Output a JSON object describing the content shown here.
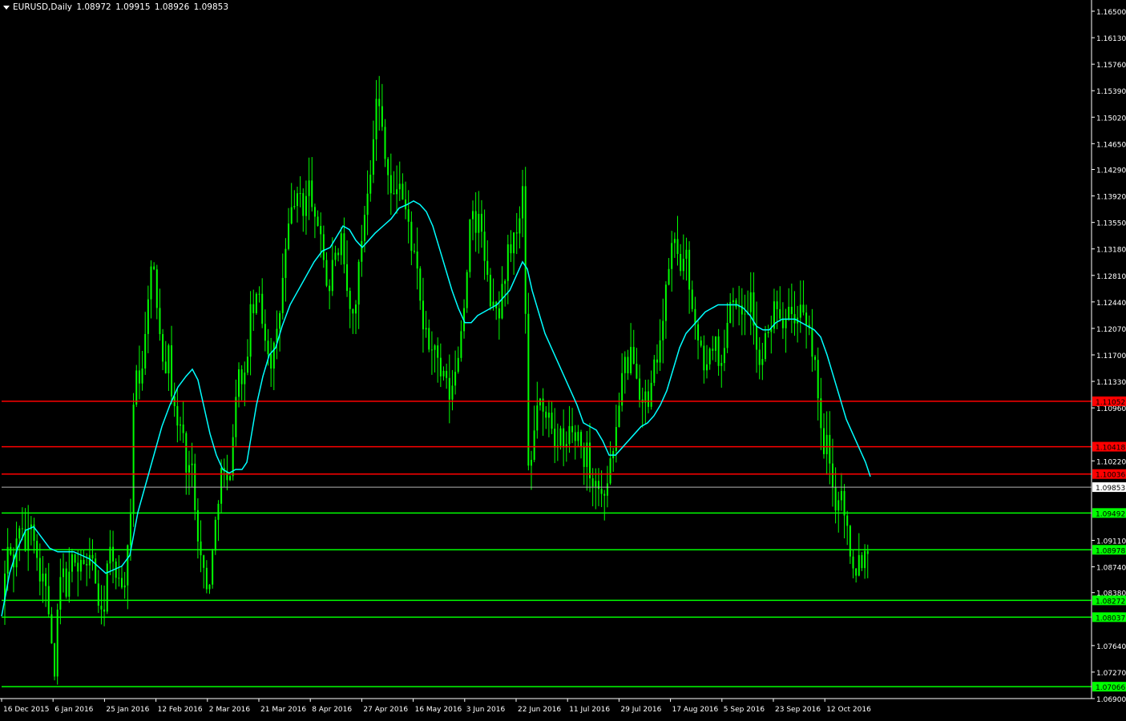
{
  "header": {
    "symbol_timeframe": "EURUSD,Daily",
    "ohlc": [
      "1.08972",
      "1.09915",
      "1.08926",
      "1.09853"
    ]
  },
  "chart_data": {
    "type": "candlestick",
    "symbol": "EURUSD",
    "timeframe": "Daily",
    "ylim": [
      1.069,
      1.165
    ],
    "y_ticks": [
      "1.16500",
      "1.16130",
      "1.15760",
      "1.15390",
      "1.15020",
      "1.14650",
      "1.14290",
      "1.13920",
      "1.13550",
      "1.13180",
      "1.12810",
      "1.12440",
      "1.12070",
      "1.11700",
      "1.11330",
      "1.10960",
      "1.10220",
      "1.09110",
      "1.08740",
      "1.08380",
      "1.07640",
      "1.07270",
      "1.06900"
    ],
    "x_labels": [
      "16 Dec 2015",
      "6 Jan 2016",
      "25 Jan 2016",
      "12 Feb 2016",
      "2 Mar 2016",
      "21 Mar 2016",
      "8 Apr 2016",
      "27 Apr 2016",
      "16 May 2016",
      "3 Jun 2016",
      "22 Jun 2016",
      "11 Jul 2016",
      "29 Jul 2016",
      "17 Aug 2016",
      "5 Sep 2016",
      "23 Sep 2016",
      "12 Oct 2016"
    ],
    "current_price": "1.09853",
    "resistance_levels": [
      "1.11052",
      "1.10418",
      "1.10036"
    ],
    "support_levels": [
      "1.09492",
      "1.08978",
      "1.08272",
      "1.08037",
      "1.07066"
    ],
    "close_path": [
      [
        0,
        1.0825
      ],
      [
        8,
        1.09
      ],
      [
        15,
        1.088
      ],
      [
        22,
        1.0935
      ],
      [
        30,
        1.09
      ],
      [
        38,
        1.095
      ],
      [
        45,
        1.087
      ],
      [
        52,
        1.086
      ],
      [
        58,
        1.082
      ],
      [
        63,
        1.075
      ],
      [
        66,
        1.072
      ],
      [
        70,
        1.081
      ],
      [
        75,
        1.088
      ],
      [
        80,
        1.084
      ],
      [
        85,
        1.086
      ],
      [
        90,
        1.09
      ],
      [
        95,
        1.087
      ],
      [
        100,
        1.089
      ],
      [
        105,
        1.086
      ],
      [
        110,
        1.09
      ],
      [
        115,
        1.087
      ],
      [
        120,
        1.083
      ],
      [
        124,
        1.08
      ],
      [
        128,
        1.082
      ],
      [
        132,
        1.088
      ],
      [
        137,
        1.09
      ],
      [
        141,
        1.085
      ],
      [
        145,
        1.088
      ],
      [
        150,
        1.084
      ],
      [
        154,
        1.086
      ],
      [
        158,
        1.09
      ],
      [
        162,
        1.095
      ],
      [
        164,
        1.108
      ],
      [
        167,
        1.118
      ],
      [
        170,
        1.112
      ],
      [
        174,
        1.115
      ],
      [
        178,
        1.117
      ],
      [
        182,
        1.125
      ],
      [
        185,
        1.128
      ],
      [
        188,
        1.13
      ],
      [
        192,
        1.126
      ],
      [
        196,
        1.122
      ],
      [
        200,
        1.118
      ],
      [
        204,
        1.115
      ],
      [
        208,
        1.118
      ],
      [
        212,
        1.112
      ],
      [
        216,
        1.11
      ],
      [
        220,
        1.106
      ],
      [
        224,
        1.108
      ],
      [
        228,
        1.104
      ],
      [
        232,
        1.1
      ],
      [
        236,
        1.103
      ],
      [
        240,
        1.098
      ],
      [
        244,
        1.093
      ],
      [
        248,
        1.089
      ],
      [
        252,
        1.087
      ],
      [
        256,
        1.084
      ],
      [
        260,
        1.086
      ],
      [
        264,
        1.09
      ],
      [
        268,
        1.095
      ],
      [
        272,
        1.099
      ],
      [
        276,
        1.102
      ],
      [
        280,
        1.098
      ],
      [
        284,
        1.1
      ],
      [
        288,
        1.105
      ],
      [
        292,
        1.11
      ],
      [
        296,
        1.116
      ],
      [
        300,
        1.112
      ],
      [
        304,
        1.114
      ],
      [
        308,
        1.119
      ],
      [
        312,
        1.125
      ],
      [
        316,
        1.122
      ],
      [
        320,
        1.127
      ],
      [
        324,
        1.123
      ],
      [
        328,
        1.12
      ],
      [
        332,
        1.118
      ],
      [
        336,
        1.116
      ],
      [
        340,
        1.118
      ],
      [
        344,
        1.12
      ],
      [
        348,
        1.124
      ],
      [
        352,
        1.129
      ],
      [
        356,
        1.133
      ],
      [
        360,
        1.136
      ],
      [
        364,
        1.139
      ],
      [
        368,
        1.138
      ],
      [
        372,
        1.14
      ],
      [
        376,
        1.137
      ],
      [
        380,
        1.139
      ],
      [
        384,
        1.141
      ],
      [
        388,
        1.138
      ],
      [
        392,
        1.134
      ],
      [
        396,
        1.136
      ],
      [
        400,
        1.133
      ],
      [
        404,
        1.128
      ],
      [
        408,
        1.125
      ],
      [
        412,
        1.129
      ],
      [
        416,
        1.132
      ],
      [
        420,
        1.13
      ],
      [
        424,
        1.133
      ],
      [
        428,
        1.128
      ],
      [
        432,
        1.125
      ],
      [
        436,
        1.122
      ],
      [
        440,
        1.123
      ],
      [
        444,
        1.127
      ],
      [
        448,
        1.132
      ],
      [
        452,
        1.136
      ],
      [
        456,
        1.14
      ],
      [
        460,
        1.143
      ],
      [
        464,
        1.148
      ],
      [
        468,
        1.153
      ],
      [
        472,
        1.151
      ],
      [
        476,
        1.148
      ],
      [
        480,
        1.144
      ],
      [
        484,
        1.141
      ],
      [
        488,
        1.138
      ],
      [
        492,
        1.14
      ],
      [
        496,
        1.142
      ],
      [
        500,
        1.139
      ],
      [
        504,
        1.137
      ],
      [
        508,
        1.135
      ],
      [
        512,
        1.132
      ],
      [
        516,
        1.13
      ],
      [
        520,
        1.127
      ],
      [
        524,
        1.122
      ],
      [
        528,
        1.12
      ],
      [
        532,
        1.119
      ],
      [
        536,
        1.117
      ],
      [
        540,
        1.119
      ],
      [
        544,
        1.116
      ],
      [
        548,
        1.113
      ],
      [
        552,
        1.115
      ],
      [
        556,
        1.112
      ],
      [
        560,
        1.111
      ],
      [
        564,
        1.113
      ],
      [
        568,
        1.116
      ],
      [
        572,
        1.119
      ],
      [
        576,
        1.123
      ],
      [
        580,
        1.128
      ],
      [
        584,
        1.135
      ],
      [
        588,
        1.136
      ],
      [
        592,
        1.134
      ],
      [
        596,
        1.138
      ],
      [
        600,
        1.132
      ],
      [
        604,
        1.129
      ],
      [
        608,
        1.126
      ],
      [
        612,
        1.123
      ],
      [
        616,
        1.124
      ],
      [
        620,
        1.122
      ],
      [
        624,
        1.126
      ],
      [
        628,
        1.128
      ],
      [
        632,
        1.132
      ],
      [
        636,
        1.13
      ],
      [
        640,
        1.134
      ],
      [
        644,
        1.133
      ],
      [
        648,
        1.138
      ],
      [
        652,
        1.142
      ],
      [
        655,
        1.106
      ],
      [
        658,
        1.099
      ],
      [
        662,
        1.103
      ],
      [
        666,
        1.108
      ],
      [
        670,
        1.112
      ],
      [
        674,
        1.109
      ],
      [
        678,
        1.107
      ],
      [
        682,
        1.11
      ],
      [
        686,
        1.108
      ],
      [
        690,
        1.105
      ],
      [
        694,
        1.104
      ],
      [
        698,
        1.106
      ],
      [
        702,
        1.103
      ],
      [
        706,
        1.105
      ],
      [
        710,
        1.108
      ],
      [
        714,
        1.104
      ],
      [
        718,
        1.107
      ],
      [
        722,
        1.105
      ],
      [
        726,
        1.102
      ],
      [
        730,
        1.104
      ],
      [
        734,
        1.101
      ],
      [
        738,
        1.099
      ],
      [
        742,
        1.1
      ],
      [
        746,
        1.098
      ],
      [
        750,
        1.097
      ],
      [
        754,
        1.099
      ],
      [
        758,
        1.101
      ],
      [
        762,
        1.103
      ],
      [
        766,
        1.106
      ],
      [
        770,
        1.11
      ],
      [
        774,
        1.114
      ],
      [
        778,
        1.116
      ],
      [
        782,
        1.113
      ],
      [
        786,
        1.119
      ],
      [
        790,
        1.116
      ],
      [
        794,
        1.114
      ],
      [
        798,
        1.11
      ],
      [
        802,
        1.113
      ],
      [
        806,
        1.108
      ],
      [
        810,
        1.112
      ],
      [
        814,
        1.115
      ],
      [
        818,
        1.117
      ],
      [
        822,
        1.12
      ],
      [
        826,
        1.122
      ],
      [
        830,
        1.127
      ],
      [
        834,
        1.131
      ],
      [
        838,
        1.133
      ],
      [
        842,
        1.132
      ],
      [
        846,
        1.13
      ],
      [
        850,
        1.129
      ],
      [
        854,
        1.131
      ],
      [
        858,
        1.127
      ],
      [
        862,
        1.124
      ],
      [
        866,
        1.12
      ],
      [
        870,
        1.118
      ],
      [
        874,
        1.117
      ],
      [
        878,
        1.115
      ],
      [
        882,
        1.116
      ],
      [
        886,
        1.118
      ],
      [
        890,
        1.12
      ],
      [
        894,
        1.117
      ],
      [
        898,
        1.115
      ],
      [
        902,
        1.118
      ],
      [
        906,
        1.123
      ],
      [
        910,
        1.125
      ],
      [
        914,
        1.126
      ],
      [
        918,
        1.124
      ],
      [
        922,
        1.122
      ],
      [
        926,
        1.124
      ],
      [
        930,
        1.123
      ],
      [
        934,
        1.126
      ],
      [
        938,
        1.122
      ],
      [
        942,
        1.118
      ],
      [
        946,
        1.115
      ],
      [
        950,
        1.117
      ],
      [
        954,
        1.12
      ],
      [
        958,
        1.119
      ],
      [
        962,
        1.123
      ],
      [
        966,
        1.125
      ],
      [
        970,
        1.124
      ],
      [
        974,
        1.121
      ],
      [
        978,
        1.123
      ],
      [
        982,
        1.125
      ],
      [
        986,
        1.123
      ],
      [
        990,
        1.121
      ],
      [
        994,
        1.124
      ],
      [
        998,
        1.123
      ],
      [
        1002,
        1.121
      ],
      [
        1006,
        1.12
      ],
      [
        1010,
        1.119
      ],
      [
        1014,
        1.116
      ],
      [
        1018,
        1.113
      ],
      [
        1022,
        1.106
      ],
      [
        1026,
        1.103
      ],
      [
        1030,
        1.105
      ],
      [
        1034,
        1.101
      ],
      [
        1038,
        1.097
      ],
      [
        1042,
        1.096
      ],
      [
        1046,
        1.099
      ],
      [
        1050,
        1.096
      ],
      [
        1054,
        1.094
      ],
      [
        1058,
        1.09
      ],
      [
        1062,
        1.088
      ],
      [
        1066,
        1.087
      ],
      [
        1070,
        1.089
      ],
      [
        1074,
        1.088
      ],
      [
        1078,
        1.09
      ],
      [
        1082,
        1.0899
      ],
      [
        1084,
        1.0985
      ]
    ],
    "ma_path": [
      [
        0,
        1.0805
      ],
      [
        10,
        1.0865
      ],
      [
        20,
        1.09
      ],
      [
        30,
        1.0925
      ],
      [
        40,
        1.093
      ],
      [
        50,
        1.0915
      ],
      [
        60,
        1.09
      ],
      [
        70,
        1.0895
      ],
      [
        80,
        1.0895
      ],
      [
        90,
        1.0895
      ],
      [
        100,
        1.089
      ],
      [
        110,
        1.0885
      ],
      [
        120,
        1.0875
      ],
      [
        130,
        1.0865
      ],
      [
        140,
        1.087
      ],
      [
        150,
        1.0875
      ],
      [
        160,
        1.089
      ],
      [
        170,
        1.095
      ],
      [
        180,
        1.099
      ],
      [
        190,
        1.103
      ],
      [
        200,
        1.107
      ],
      [
        210,
        1.11
      ],
      [
        220,
        1.1125
      ],
      [
        230,
        1.114
      ],
      [
        238,
        1.115
      ],
      [
        245,
        1.1135
      ],
      [
        252,
        1.11
      ],
      [
        260,
        1.106
      ],
      [
        268,
        1.103
      ],
      [
        276,
        1.101
      ],
      [
        284,
        1.1005
      ],
      [
        292,
        1.101
      ],
      [
        300,
        1.101
      ],
      [
        306,
        1.102
      ],
      [
        312,
        1.106
      ],
      [
        318,
        1.11
      ],
      [
        326,
        1.114
      ],
      [
        334,
        1.117
      ],
      [
        342,
        1.118
      ],
      [
        350,
        1.121
      ],
      [
        360,
        1.124
      ],
      [
        370,
        1.126
      ],
      [
        380,
        1.128
      ],
      [
        390,
        1.13
      ],
      [
        400,
        1.1315
      ],
      [
        410,
        1.132
      ],
      [
        418,
        1.1335
      ],
      [
        426,
        1.135
      ],
      [
        434,
        1.1345
      ],
      [
        442,
        1.133
      ],
      [
        450,
        1.132
      ],
      [
        458,
        1.133
      ],
      [
        466,
        1.134
      ],
      [
        476,
        1.135
      ],
      [
        486,
        1.136
      ],
      [
        496,
        1.1375
      ],
      [
        506,
        1.138
      ],
      [
        514,
        1.1385
      ],
      [
        522,
        1.138
      ],
      [
        530,
        1.137
      ],
      [
        538,
        1.135
      ],
      [
        546,
        1.132
      ],
      [
        554,
        1.129
      ],
      [
        562,
        1.126
      ],
      [
        570,
        1.1235
      ],
      [
        578,
        1.1215
      ],
      [
        586,
        1.1215
      ],
      [
        594,
        1.1225
      ],
      [
        602,
        1.123
      ],
      [
        610,
        1.1235
      ],
      [
        618,
        1.124
      ],
      [
        626,
        1.125
      ],
      [
        634,
        1.126
      ],
      [
        642,
        1.128
      ],
      [
        650,
        1.13
      ],
      [
        656,
        1.129
      ],
      [
        662,
        1.126
      ],
      [
        670,
        1.123
      ],
      [
        678,
        1.12
      ],
      [
        686,
        1.118
      ],
      [
        694,
        1.116
      ],
      [
        702,
        1.114
      ],
      [
        710,
        1.112
      ],
      [
        718,
        1.11
      ],
      [
        726,
        1.1075
      ],
      [
        734,
        1.107
      ],
      [
        742,
        1.1065
      ],
      [
        750,
        1.105
      ],
      [
        758,
        1.103
      ],
      [
        766,
        1.103
      ],
      [
        774,
        1.104
      ],
      [
        782,
        1.105
      ],
      [
        790,
        1.106
      ],
      [
        798,
        1.107
      ],
      [
        806,
        1.1075
      ],
      [
        814,
        1.1085
      ],
      [
        822,
        1.11
      ],
      [
        830,
        1.112
      ],
      [
        838,
        1.115
      ],
      [
        846,
        1.118
      ],
      [
        854,
        1.12
      ],
      [
        862,
        1.121
      ],
      [
        870,
        1.122
      ],
      [
        878,
        1.123
      ],
      [
        886,
        1.1235
      ],
      [
        894,
        1.124
      ],
      [
        902,
        1.124
      ],
      [
        910,
        1.124
      ],
      [
        918,
        1.124
      ],
      [
        926,
        1.1235
      ],
      [
        934,
        1.1225
      ],
      [
        942,
        1.121
      ],
      [
        950,
        1.1205
      ],
      [
        958,
        1.1205
      ],
      [
        966,
        1.1215
      ],
      [
        974,
        1.122
      ],
      [
        982,
        1.122
      ],
      [
        990,
        1.122
      ],
      [
        998,
        1.1215
      ],
      [
        1006,
        1.121
      ],
      [
        1014,
        1.1205
      ],
      [
        1022,
        1.1195
      ],
      [
        1030,
        1.117
      ],
      [
        1038,
        1.114
      ],
      [
        1046,
        1.111
      ],
      [
        1054,
        1.108
      ],
      [
        1062,
        1.106
      ],
      [
        1070,
        1.104
      ],
      [
        1078,
        1.102
      ],
      [
        1084,
        1.1
      ]
    ],
    "colors": {
      "background": "#000000",
      "bars": "#00ff00",
      "moving_average": "#00ffff",
      "resistance": "#ff0000",
      "support": "#00ff00",
      "current_price_line": "#b4b4b4",
      "axis_text": "#ffffff"
    }
  }
}
